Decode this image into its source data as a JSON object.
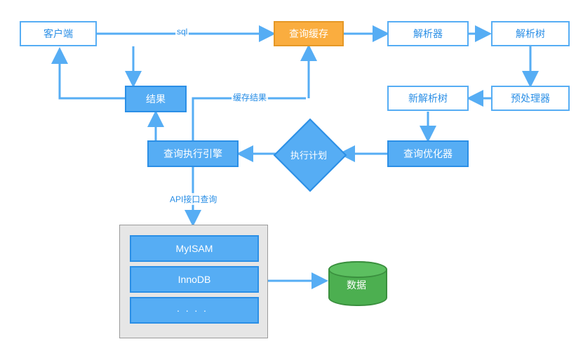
{
  "nodes": {
    "client": {
      "label": "客户端"
    },
    "cache": {
      "label": "查询缓存"
    },
    "parser": {
      "label": "解析器"
    },
    "parse_tree": {
      "label": "解析树"
    },
    "preproc": {
      "label": "预处理器"
    },
    "new_tree": {
      "label": "新解析树"
    },
    "optimizer": {
      "label": "查询优化器"
    },
    "plan": {
      "label": "执行计划"
    },
    "executor": {
      "label": "查询执行引擎"
    },
    "result": {
      "label": "结果"
    },
    "data": {
      "label": "数据"
    }
  },
  "engines": {
    "myisam": {
      "label": "MyISAM"
    },
    "innodb": {
      "label": "InnoDB"
    },
    "more": {
      "label": "····"
    }
  },
  "edge_labels": {
    "sql": "sql",
    "cache_result": "缓存结果",
    "api_query": "API接口查询"
  },
  "colors": {
    "blue": "#56adf4",
    "blue_border": "#2b8fe6",
    "orange": "#faad3f",
    "green": "#4caf50",
    "gray": "#e6e6e6"
  }
}
